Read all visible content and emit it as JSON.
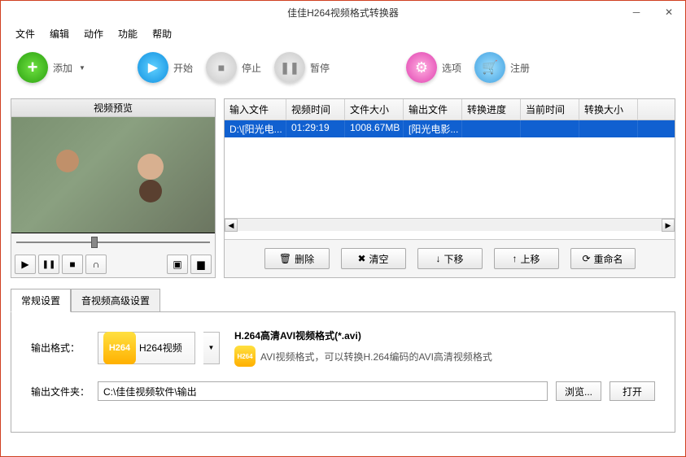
{
  "window": {
    "title": "佳佳H264视频格式转换器"
  },
  "menu": [
    "文件",
    "编辑",
    "动作",
    "功能",
    "帮助"
  ],
  "toolbar": {
    "add": "添加",
    "start": "开始",
    "stop": "停止",
    "pause": "暂停",
    "options": "选项",
    "register": "注册"
  },
  "preview": {
    "header": "视频预览"
  },
  "table": {
    "headers": [
      "输入文件",
      "视频时间",
      "文件大小",
      "输出文件",
      "转换进度",
      "当前时间",
      "转换大小"
    ],
    "rows": [
      {
        "input": "D:\\[阳光电...",
        "duration": "01:29:19",
        "size": "1008.67MB",
        "output": "[阳光电影...",
        "progress": "",
        "time": "",
        "outsize": ""
      }
    ]
  },
  "actions": {
    "delete": "删除",
    "clear": "清空",
    "down": "下移",
    "up": "上移",
    "rename": "重命名"
  },
  "tabs": {
    "general": "常规设置",
    "advanced": "音视频高级设置"
  },
  "form": {
    "format_label": "输出格式：",
    "format_badge": "H264",
    "format_name": "H264视频",
    "format_title": "H.264高清AVI视频格式(*.avi)",
    "format_desc": "AVI视频格式，可以转换H.264编码的AVI高清视频格式",
    "folder_label": "输出文件夹：",
    "folder_value": "C:\\佳佳视频软件\\输出",
    "browse": "浏览...",
    "open": "打开"
  }
}
